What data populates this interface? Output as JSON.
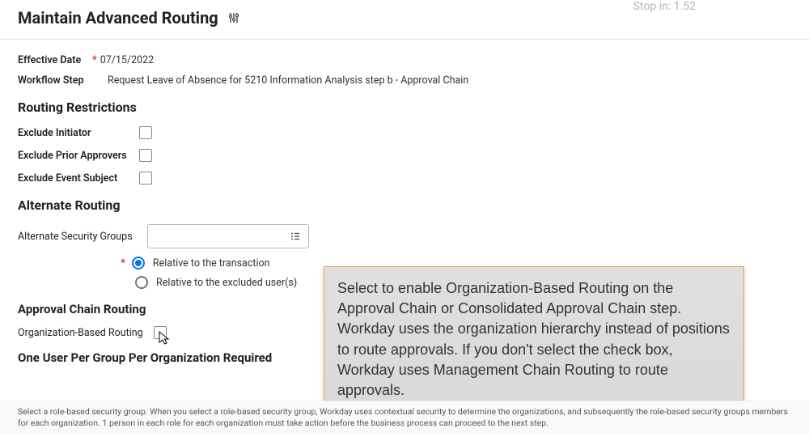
{
  "top_faded": "Stop in: 1.52",
  "page_title": "Maintain Advanced Routing",
  "effective_date": {
    "label": "Effective Date",
    "value": "07/15/2022"
  },
  "workflow_step": {
    "label": "Workflow Step",
    "value": "Request Leave of Absence for 5210 Information Analysis step b - Approval Chain"
  },
  "sections": {
    "routing_restrictions": "Routing Restrictions",
    "alternate_routing": "Alternate Routing",
    "approval_chain_routing": "Approval Chain Routing",
    "one_user": "One User Per Group Per Organization Required"
  },
  "checkboxes": {
    "exclude_initiator": "Exclude Initiator",
    "exclude_prior_approvers": "Exclude Prior Approvers",
    "exclude_event_subject": "Exclude Event Subject"
  },
  "alternate_security_groups": {
    "label": "Alternate Security Groups",
    "placeholder": ""
  },
  "radios": {
    "relative_transaction": "Relative to the transaction",
    "relative_excluded": "Relative to the excluded user(s)"
  },
  "obr": {
    "label": "Organization-Based Routing"
  },
  "tooltip": "Select to enable Organization-Based Routing on the Approval Chain or Consolidated Approval Chain step. Workday uses the organization hierarchy instead of positions to route approvals. If you don't select the check box, Workday uses Management Chain Routing to route approvals.",
  "footer_text": "Select a role-based security group. When you select a role-based security group, Workday uses contextual security to determine the organizations, and subsequently the role-based security groups members for each organization. 1 person in each role for each organization must take action before the business process can proceed to the next step."
}
